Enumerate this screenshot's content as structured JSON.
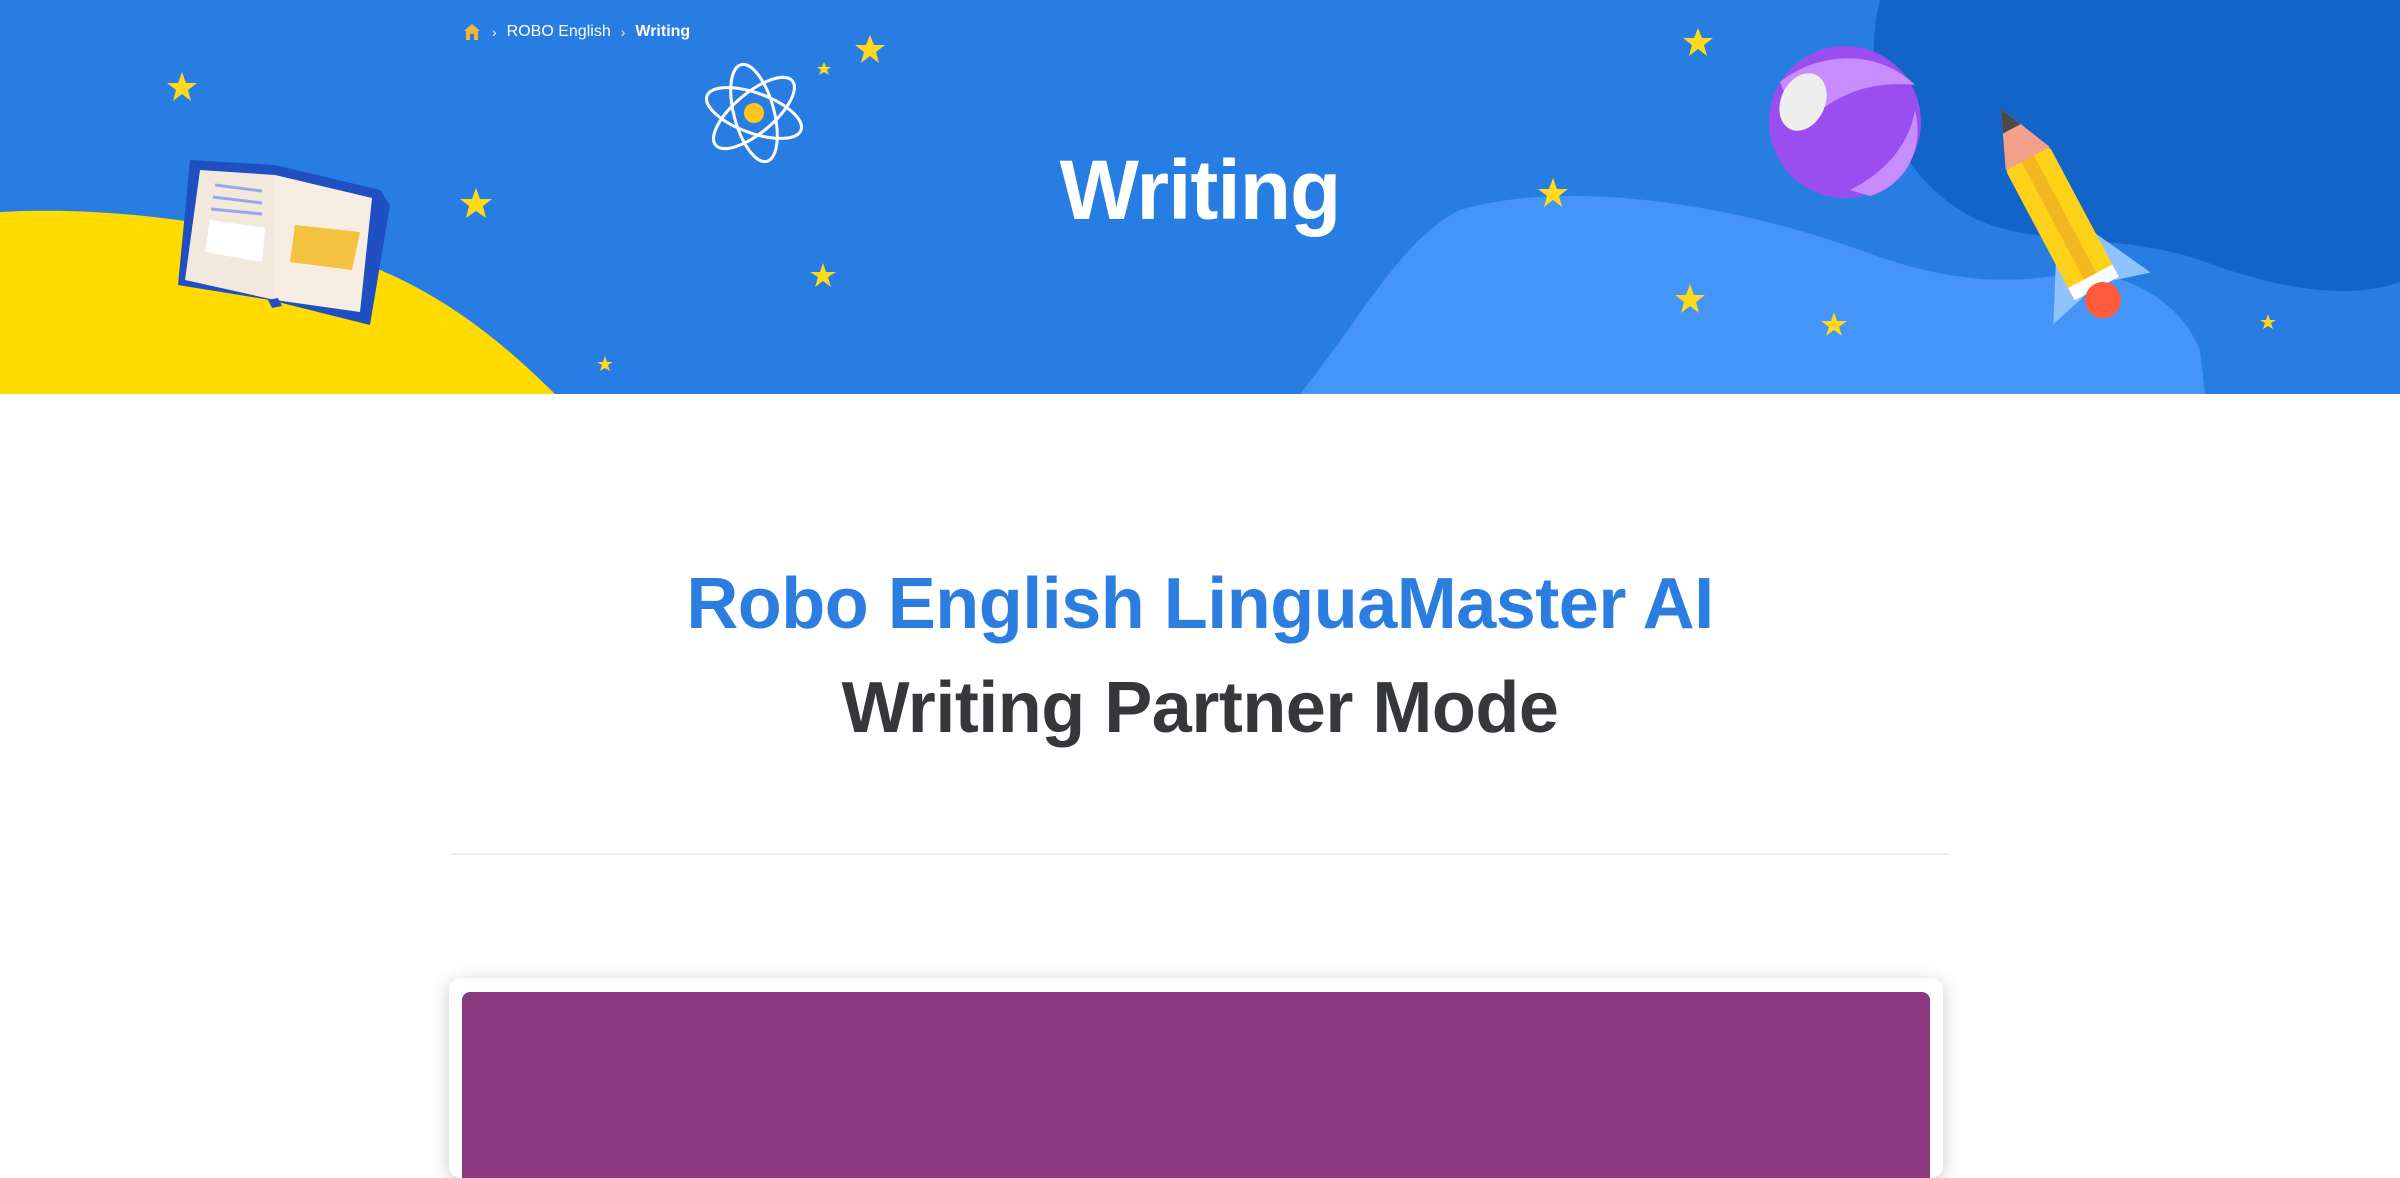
{
  "breadcrumb": {
    "home_icon": "home-icon",
    "separator_icon": "chevron-right-icon",
    "items": [
      {
        "label": "ROBO English"
      },
      {
        "label": "Writing"
      }
    ]
  },
  "hero": {
    "title": "Writing",
    "colors": {
      "sky": "#277de2",
      "hill": "#4594f7",
      "corner": "#1264c9",
      "sand": "#ffdb00",
      "star": "#ffd91a"
    },
    "decorations": [
      "open-book-illustration",
      "atom-illustration",
      "beach-ball-illustration",
      "pencil-rocket-illustration",
      "star-icons"
    ]
  },
  "main": {
    "heading_line1": "Robo English LinguaMaster AI",
    "heading_line2": "Writing Partner Mode",
    "accent_color": "#2b7de0",
    "heading_color": "#35373b"
  },
  "embed": {
    "background_color": "#8a3880"
  }
}
